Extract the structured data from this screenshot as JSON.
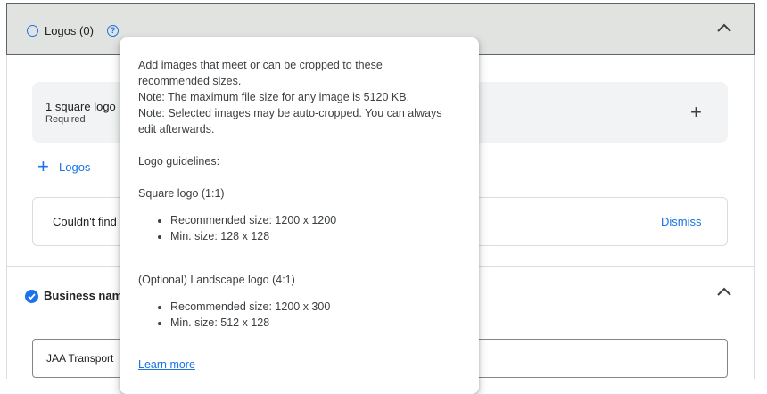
{
  "logos_section": {
    "title": "Logos (0)",
    "help_icon": "help-circle-icon",
    "status_icon": "empty-circle-icon",
    "collapse_icon": "chevron-up-icon"
  },
  "logo_card": {
    "title": "1 square logo",
    "subtitle": "Required",
    "add_icon": "plus-icon"
  },
  "add_logos": {
    "label": "Logos",
    "icon": "plus-icon"
  },
  "notice": {
    "text": "Couldn't find",
    "dismiss_label": "Dismiss"
  },
  "business_name_section": {
    "title": "Business name",
    "status_icon": "check-circle-icon",
    "collapse_icon": "chevron-up-icon",
    "input_value": "JAA Transport"
  },
  "tooltip": {
    "intro_lines": [
      "Add images that meet or can be cropped to these",
      "recommended sizes.",
      "Note: The maximum file size for any image is 5120 KB.",
      "Note: Selected images may be auto-cropped. You can always",
      "edit afterwards."
    ],
    "guidelines_heading": "Logo guidelines:",
    "square_heading": "Square logo (1:1)",
    "square_items": [
      "Recommended size: 1200 x 1200",
      "Min. size: 128 x 128"
    ],
    "landscape_heading": "(Optional) Landscape logo (4:1)",
    "landscape_items": [
      "Recommended size: 1200 x 300",
      "Min. size: 512 x 128"
    ],
    "learn_more": "Learn more"
  },
  "colors": {
    "accent": "#1a73e8",
    "header_bg": "#e1e3e1",
    "card_bg": "#f1f3f4"
  }
}
